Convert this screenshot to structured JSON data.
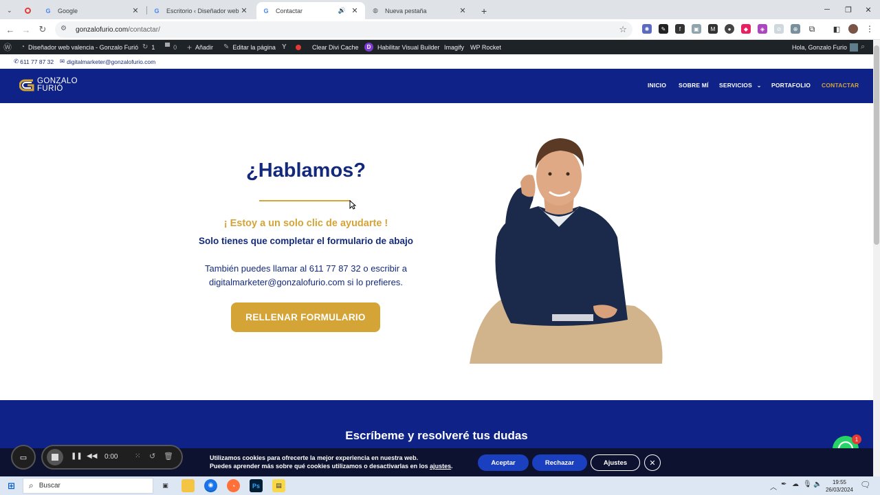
{
  "browser": {
    "tabs": [
      {
        "title": "",
        "favicon": "recording-dot"
      },
      {
        "title": "Google",
        "favicon": "G"
      },
      {
        "title": "Escritorio ‹ Diseñador web valenc",
        "favicon": "G"
      },
      {
        "title": "Contactar",
        "favicon": "G",
        "active": true
      },
      {
        "title": "Nueva pestaña",
        "favicon": "globe"
      }
    ],
    "address": {
      "host": "gonzalofurio.com",
      "path": "/contactar/"
    }
  },
  "wp_admin_bar": {
    "site_name": "Diseñador web valencia - Gonzalo Furió",
    "updates": "1",
    "comments": "0",
    "add_new": "Añadir",
    "edit_page": "Editar la página",
    "clear_cache": "Clear Divi Cache",
    "visual_builder": "Habilitar Visual Builder",
    "imagify": "Imagify",
    "wp_rocket": "WP Rocket",
    "greeting": "Hola, Gonzalo Furio"
  },
  "topbar": {
    "phone": "611 77 87 32",
    "email": "digitalmarketer@gonzalofurio.com"
  },
  "site": {
    "logo_line1": "GONZALO",
    "logo_line2": "FURIÓ",
    "menu": {
      "inicio": "INICIO",
      "sobre_mi": "SOBRE MÍ",
      "servicios": "SERVICIOS",
      "portafolio": "PORTAFOLIO",
      "contactar": "CONTACTAR"
    }
  },
  "hero": {
    "title": "¿Hablamos?",
    "accent": "¡ Estoy a un solo clic de ayudarte !",
    "subtitle": "Solo tienes que completar el formulario de abajo",
    "body_line1": "También puedes llamar al 611 77 87 32 o escribir a",
    "body_line2": "digitalmarketer@gonzalofurio.com si lo prefieres.",
    "cta": "RELLENAR FORMULARIO"
  },
  "section2": {
    "title": "Escríbeme y resolveré tus dudas"
  },
  "cookies": {
    "line1": "Utilizamos cookies para ofrecerte la mejor experiencia en nuestra web.",
    "line2_prefix": "Puedes aprender más sobre qué cookies utilizamos o desactivarlas en los ",
    "line2_link": "ajustes",
    "line2_suffix": ".",
    "accept": "Aceptar",
    "reject": "Rechazar",
    "settings": "Ajustes"
  },
  "recorder": {
    "time": "0:00"
  },
  "whatsapp": {
    "badge": "1"
  },
  "taskbar": {
    "search_placeholder": "Buscar",
    "time": "19:55",
    "date": "26/03/2024"
  },
  "colors": {
    "brand_blue": "#0e2287",
    "accent_gold": "#d4a436",
    "heading_blue": "#132a7c"
  }
}
